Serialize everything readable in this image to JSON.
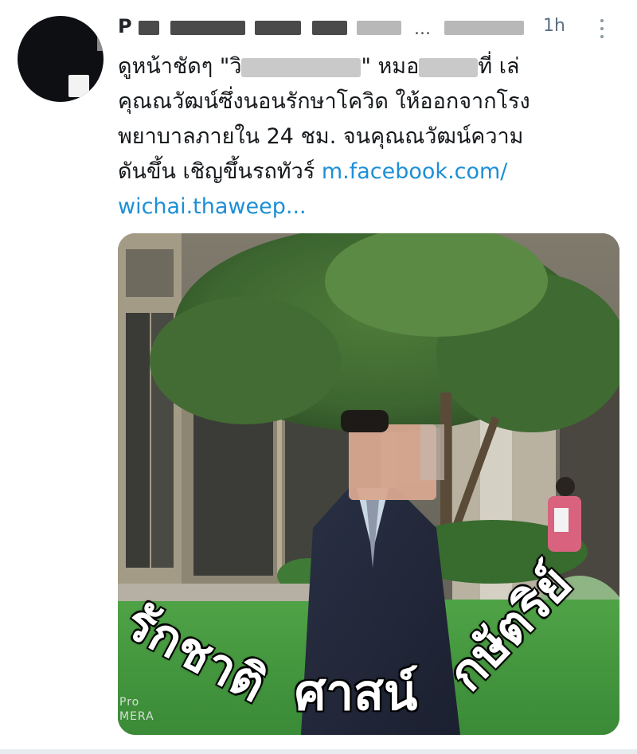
{
  "tweet": {
    "author_visible_prefix": "P",
    "author_visible_suffix": "...",
    "time": "1h",
    "text": {
      "line1_a": "ดูหน้าชัดๆ \"วิ",
      "line1_b": "\" หมอ",
      "line1_c": "ที่ เล่",
      "line2": "คุณณวัฒน์ซึ่งนอนรักษาโควิด ให้ออกจากโรง",
      "line3": "พยาบาลภายใน 24 ชม. จนคุณณวัฒน์ความ",
      "line4_a": "ดันขึ้น เชิญขึ้นรถทัวร์ ",
      "link_a": "m.facebook.com/",
      "link_b": "wichai.thaweep..."
    },
    "media": {
      "overlay_word_1": "รักชาติ",
      "overlay_word_2": "ศาสน์",
      "overlay_word_3": "กษัตริย์",
      "watermark_line1": "Pro",
      "watermark_line2": "MERA"
    }
  },
  "colors": {
    "link": "#1d8fd6",
    "time": "#5b7083",
    "text": "#16191c"
  },
  "icons": {
    "more": "vertical-ellipsis-icon"
  }
}
